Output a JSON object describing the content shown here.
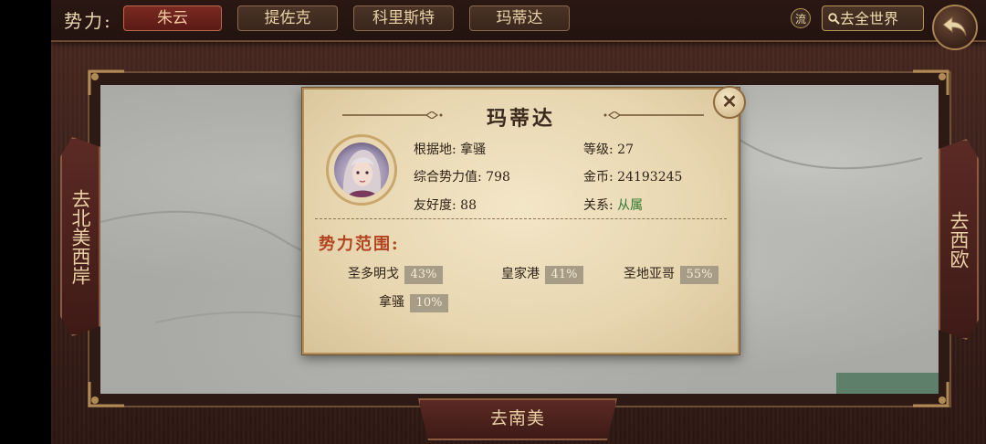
{
  "topbar": {
    "faction_label": "势力:",
    "tabs": [
      {
        "label": "朱云",
        "active": true
      },
      {
        "label": "提佐克",
        "active": false
      },
      {
        "label": "科里斯特",
        "active": false
      },
      {
        "label": "玛蒂达",
        "active": false
      }
    ],
    "liu_label": "流",
    "world_button": "去全世界",
    "back_icon": "return-arrow-icon"
  },
  "nav": {
    "left": "去北美西岸",
    "right": "去西欧",
    "bottom": "去南美"
  },
  "popup": {
    "title": "玛蒂达",
    "close_icon": "close-icon",
    "info": {
      "base_label": "根据地:",
      "base_value": "拿骚",
      "level_label": "等级:",
      "level_value": "27",
      "power_label": "综合势力值:",
      "power_value": "798",
      "gold_label": "金币:",
      "gold_value": "24193245",
      "friend_label": "友好度:",
      "friend_value": "88",
      "relation_label": "关系:",
      "relation_value": "从属"
    },
    "range_title": "势力范围:",
    "regions": [
      {
        "name": "圣多明戈",
        "pct": "43%"
      },
      {
        "name": "皇家港",
        "pct": "41%"
      },
      {
        "name": "圣地亚哥",
        "pct": "55%"
      },
      {
        "name": "拿骚",
        "pct": "10%"
      }
    ]
  },
  "colors": {
    "relation_green": "#2f7a2f",
    "range_title_red": "#b2431f",
    "active_tab": "#7a2a22"
  }
}
